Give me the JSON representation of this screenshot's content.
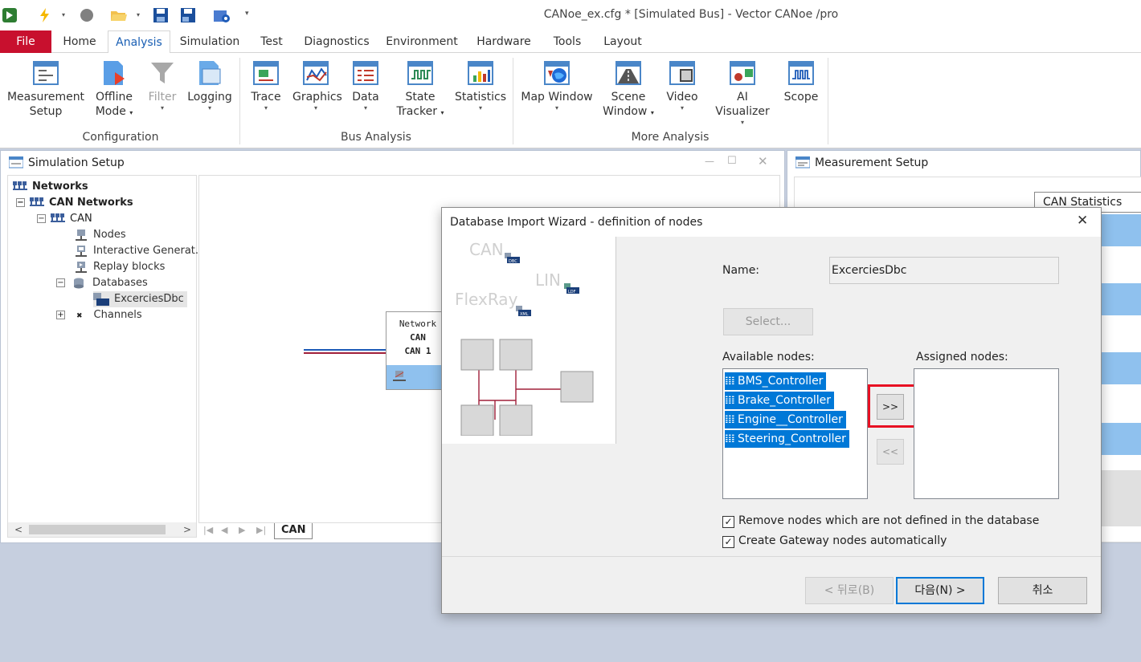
{
  "window": {
    "title": "CANoe_ex.cfg * [Simulated Bus] - Vector CANoe /pro"
  },
  "quick_access": [
    "app-logo-icon",
    "lightning-icon",
    "stop-icon",
    "open-folder-icon",
    "save-icon",
    "save-as-icon",
    "config-icon"
  ],
  "ribbon_tabs": [
    "File",
    "Home",
    "Analysis",
    "Simulation",
    "Test",
    "Diagnostics",
    "Environment",
    "Hardware",
    "Tools",
    "Layout"
  ],
  "ribbon": {
    "configuration": {
      "label": "Configuration",
      "measurement_setup": [
        "Measurement",
        "Setup"
      ],
      "offline_mode": [
        "Offline",
        "Mode"
      ],
      "filter": "Filter",
      "logging": "Logging"
    },
    "bus_analysis": {
      "label": "Bus Analysis",
      "trace": "Trace",
      "graphics": "Graphics",
      "data": "Data",
      "state_tracker": [
        "State",
        "Tracker"
      ],
      "statistics": "Statistics"
    },
    "more_analysis": {
      "label": "More Analysis",
      "map_window": "Map Window",
      "scene_window": [
        "Scene",
        "Window"
      ],
      "video": "Video",
      "ai_visualizer": "AI Visualizer",
      "scope": "Scope"
    }
  },
  "simulation_setup": {
    "title": "Simulation Setup",
    "tree": {
      "networks": "Networks",
      "can_networks": "CAN Networks",
      "can": "CAN",
      "nodes": "Nodes",
      "interactive_generators": "Interactive Generat...",
      "replay_blocks": "Replay blocks",
      "databases": "Databases",
      "db_item": "ExcerciesDbc",
      "channels": "Channels"
    },
    "network_block": {
      "line1": "Network",
      "line2": "CAN",
      "line3": "CAN 1"
    },
    "canvas_tab": "CAN"
  },
  "measurement_setup": {
    "title": "Measurement Setup",
    "block": "CAN Statistics"
  },
  "dialog": {
    "title": "Database Import Wizard - definition of nodes",
    "illustration": {
      "can": "CAN",
      "lin": "LIN",
      "flexray": "FlexRay",
      "badges": {
        "dbc": "DBC",
        "ldf": "LDF",
        "xml": "XML"
      }
    },
    "name_label": "Name:",
    "name_value": "ExcerciesDbc",
    "select_button": "Select...",
    "available_label": "Available nodes:",
    "assigned_label": "Assigned nodes:",
    "available_nodes": [
      "BMS_Controller",
      "Brake_Controller",
      "Engine__Controller",
      "Steering_Controller"
    ],
    "assigned_nodes": [],
    "assign_button": ">>",
    "unassign_button": "<<",
    "remove_nodes_label": "Remove nodes which are not defined in the database",
    "remove_nodes_checked": true,
    "gateway_label": "Create Gateway nodes automatically",
    "gateway_checked": true,
    "back_button": "< 뒤로(B)",
    "next_button": "다음(N) >",
    "cancel_button": "취소",
    "checkmark": "✓"
  },
  "colors": {
    "accent": "#0078d7",
    "file_tab": "#c8102e",
    "highlight_box": "#e81123"
  }
}
